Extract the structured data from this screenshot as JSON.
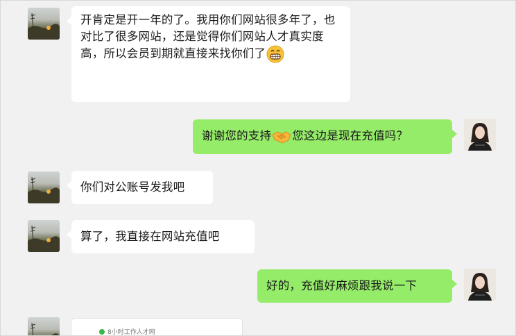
{
  "chat": {
    "messages": [
      {
        "side": "in",
        "text_before": "开肯定是开一年的了。我用你们网站很多年了，也对比了很多网站，还是觉得你们网站人才真实度高，所以会员到期就直接来找你们了",
        "emoji": "grinning-face-icon"
      },
      {
        "side": "out",
        "text_before": "谢谢您的支持",
        "emoji": "handshake-icon",
        "text_after": "您这边是现在充值吗？"
      },
      {
        "side": "in",
        "text": "你们对公账号发我吧"
      },
      {
        "side": "in",
        "text": "算了，我直接在网站充值吧"
      },
      {
        "side": "out",
        "text": "好的，充值好麻烦跟我说一下"
      }
    ],
    "card": {
      "site_name": "8小时工作人才网"
    }
  },
  "colors": {
    "outgoing_bubble": "#95ec69",
    "incoming_bubble": "#ffffff",
    "background": "#f1f1f1"
  }
}
